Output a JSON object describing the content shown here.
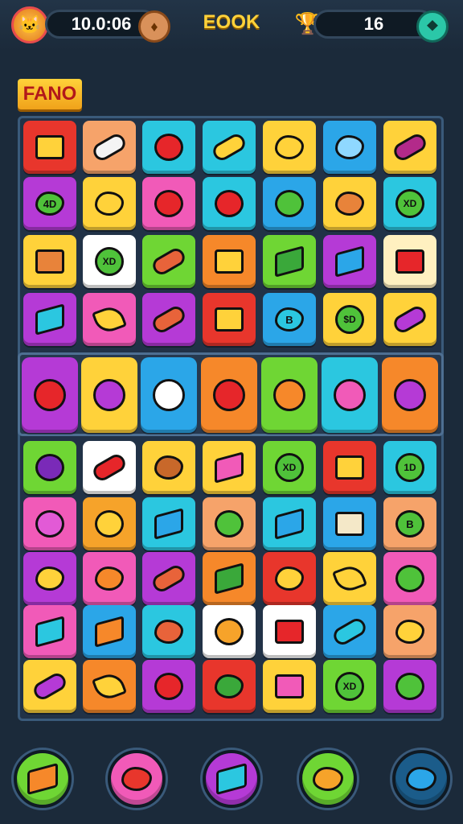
{
  "header": {
    "score_value": "10.0:06",
    "title": "EOOK",
    "right_counter": "16",
    "avatar_icon": "cat-face-icon",
    "left_coin_icon": "coin-icon",
    "right_trophy_icon": "trophy-icon",
    "right_action_icon": "leaf-icon"
  },
  "level": {
    "tag": "FANO"
  },
  "board": {
    "rows": [
      [
        {
          "bg": "#e8362c",
          "fill": "#ffd23a",
          "shape": "box",
          "icon": "crate-icon",
          "label": ""
        },
        {
          "bg": "#f6a36a",
          "fill": "#f4f4f4",
          "shape": "bar",
          "icon": "soap-icon",
          "label": ""
        },
        {
          "bg": "#2bc7e0",
          "fill": "#e6262a",
          "shape": "round",
          "icon": "tomato-icon",
          "label": ""
        },
        {
          "bg": "#2bc7e0",
          "fill": "#ffd23a",
          "shape": "bar",
          "icon": "banana-icon",
          "label": ""
        },
        {
          "bg": "#ffd23a",
          "fill": "#ffd23a",
          "shape": "blob",
          "icon": "bread-icon",
          "label": ""
        },
        {
          "bg": "#2ba6e8",
          "fill": "#8fd8ff",
          "shape": "blob",
          "icon": "flower-icon",
          "label": ""
        },
        {
          "bg": "#ffd23a",
          "fill": "#b32a8a",
          "shape": "bar",
          "icon": "eggplant-icon",
          "label": ""
        }
      ],
      [
        {
          "bg": "#b53ad6",
          "fill": "#4fc23a",
          "shape": "blob",
          "icon": "leaf-icon",
          "label": "4D"
        },
        {
          "bg": "#ffd23a",
          "fill": "#ffd23a",
          "shape": "blob",
          "icon": "bread-icon",
          "label": ""
        },
        {
          "bg": "#f15ab8",
          "fill": "#e6262a",
          "shape": "round",
          "icon": "tomato-icon",
          "label": ""
        },
        {
          "bg": "#2bc7e0",
          "fill": "#e6262a",
          "shape": "round",
          "icon": "tomato-icon",
          "label": ""
        },
        {
          "bg": "#2ba6e8",
          "fill": "#4fc23a",
          "shape": "round",
          "icon": "apple-icon",
          "label": ""
        },
        {
          "bg": "#ffd23a",
          "fill": "#e8833a",
          "shape": "blob",
          "icon": "potato-icon",
          "label": ""
        },
        {
          "bg": "#2bc7e0",
          "fill": "#4fc23a",
          "shape": "coin",
          "icon": "token-icon",
          "label": "XD"
        }
      ],
      [
        {
          "bg": "#ffd23a",
          "fill": "#e8833a",
          "shape": "box",
          "icon": "crate-icon",
          "label": ""
        },
        {
          "bg": "#ffffff",
          "fill": "#4fc23a",
          "shape": "coin",
          "icon": "token-icon",
          "label": "XD"
        },
        {
          "bg": "#6fd634",
          "fill": "#e8633a",
          "shape": "bar",
          "icon": "carrot-icon",
          "label": ""
        },
        {
          "bg": "#f6882a",
          "fill": "#ffd23a",
          "shape": "box",
          "icon": "crate-icon",
          "label": ""
        },
        {
          "bg": "#6fd634",
          "fill": "#3aa83a",
          "shape": "cube",
          "icon": "block-icon",
          "label": ""
        },
        {
          "bg": "#b53ad6",
          "fill": "#2ba6e8",
          "shape": "cube",
          "icon": "block-icon",
          "label": ""
        },
        {
          "bg": "#fff0c0",
          "fill": "#e6262a",
          "shape": "box",
          "icon": "berry-icon",
          "label": ""
        }
      ],
      [
        {
          "bg": "#b53ad6",
          "fill": "#2bc7e0",
          "shape": "cube",
          "icon": "block-icon",
          "label": ""
        },
        {
          "bg": "#f15ab8",
          "fill": "#ffd23a",
          "shape": "wedge",
          "icon": "cheese-icon",
          "label": ""
        },
        {
          "bg": "#b53ad6",
          "fill": "#e8633a",
          "shape": "bar",
          "icon": "carrot-icon",
          "label": ""
        },
        {
          "bg": "#e8362c",
          "fill": "#ffd23a",
          "shape": "box",
          "icon": "cheese-block-icon",
          "label": ""
        },
        {
          "bg": "#2ba6e8",
          "fill": "#2bc7e0",
          "shape": "blob",
          "icon": "shield-icon",
          "label": "B"
        },
        {
          "bg": "#ffd23a",
          "fill": "#4fc23a",
          "shape": "coin",
          "icon": "token-icon",
          "label": "$D"
        },
        {
          "bg": "#ffd23a",
          "fill": "#b53ad6",
          "shape": "bar",
          "icon": "radish-icon",
          "label": ""
        }
      ]
    ],
    "special_row": [
      {
        "bg": "#b53ad6",
        "fill": "#e6262a",
        "icon": "lollipop-icon"
      },
      {
        "bg": "#ffd23a",
        "fill": "#b53ad6",
        "icon": "lollipop-icon"
      },
      {
        "bg": "#2ba6e8",
        "fill": "#ffffff",
        "icon": "onion-icon"
      },
      {
        "bg": "#f6882a",
        "fill": "#e6262a",
        "icon": "jelly-icon"
      },
      {
        "bg": "#6fd634",
        "fill": "#f6882a",
        "icon": "pineapple-icon"
      },
      {
        "bg": "#2bc7e0",
        "fill": "#f15ab8",
        "icon": "candy-cube-icon"
      },
      {
        "bg": "#f6882a",
        "fill": "#b53ad6",
        "icon": "lollipop-icon"
      }
    ],
    "rows_lower": [
      [
        {
          "bg": "#6fd634",
          "fill": "#7a2ab8",
          "shape": "round",
          "icon": "plum-icon",
          "label": ""
        },
        {
          "bg": "#ffffff",
          "fill": "#e6262a",
          "shape": "bar",
          "icon": "candy-bar-icon",
          "label": ""
        },
        {
          "bg": "#ffd23a",
          "fill": "#c8682a",
          "shape": "blob",
          "icon": "potato-icon",
          "label": ""
        },
        {
          "bg": "#ffd23a",
          "fill": "#f15ab8",
          "shape": "cube",
          "icon": "candy-cube-icon",
          "label": ""
        },
        {
          "bg": "#6fd634",
          "fill": "#4fc23a",
          "shape": "coin",
          "icon": "token-icon",
          "label": "XD"
        },
        {
          "bg": "#e8362c",
          "fill": "#ffd23a",
          "shape": "box",
          "icon": "crate-icon",
          "label": ""
        },
        {
          "bg": "#2bc7e0",
          "fill": "#4fc23a",
          "shape": "coin",
          "icon": "token-icon",
          "label": "1D"
        }
      ],
      [
        {
          "bg": "#f15ab8",
          "fill": "#e25ad6",
          "shape": "round",
          "icon": "peach-icon",
          "label": ""
        },
        {
          "bg": "#f6a32a",
          "fill": "#ffd23a",
          "shape": "round",
          "icon": "lemon-icon",
          "label": ""
        },
        {
          "bg": "#2bc7e0",
          "fill": "#2ba6e8",
          "shape": "cube",
          "icon": "block-icon",
          "label": ""
        },
        {
          "bg": "#f6a36a",
          "fill": "#4fc23a",
          "shape": "round",
          "icon": "apple-icon",
          "label": ""
        },
        {
          "bg": "#2bc7e0",
          "fill": "#2ba6e8",
          "shape": "cube",
          "icon": "block-icon",
          "label": ""
        },
        {
          "bg": "#2ba6e8",
          "fill": "#f4e8c8",
          "shape": "box",
          "icon": "box-icon",
          "label": ""
        },
        {
          "bg": "#f6a36a",
          "fill": "#4fc23a",
          "shape": "round",
          "icon": "apple-icon",
          "label": "B"
        }
      ],
      [
        {
          "bg": "#b53ad6",
          "fill": "#ffd23a",
          "shape": "blob",
          "icon": "bread-icon",
          "label": ""
        },
        {
          "bg": "#f15ab8",
          "fill": "#f6882a",
          "shape": "blob",
          "icon": "berry-icon",
          "label": ""
        },
        {
          "bg": "#b53ad6",
          "fill": "#e8633a",
          "shape": "bar",
          "icon": "carrot-icon",
          "label": ""
        },
        {
          "bg": "#f6882a",
          "fill": "#3aa83a",
          "shape": "cube",
          "icon": "block-icon",
          "label": ""
        },
        {
          "bg": "#e8362c",
          "fill": "#ffd23a",
          "shape": "blob",
          "icon": "bread-icon",
          "label": ""
        },
        {
          "bg": "#ffd23a",
          "fill": "#ffd23a",
          "shape": "wedge",
          "icon": "cheese-icon",
          "label": ""
        },
        {
          "bg": "#f15ab8",
          "fill": "#4fc23a",
          "shape": "round",
          "icon": "apple-icon",
          "label": ""
        }
      ],
      [
        {
          "bg": "#f15ab8",
          "fill": "#2bc7e0",
          "shape": "cube",
          "icon": "block-icon",
          "label": ""
        },
        {
          "bg": "#2ba6e8",
          "fill": "#f6882a",
          "shape": "cube",
          "icon": "block-icon",
          "label": ""
        },
        {
          "bg": "#2bc7e0",
          "fill": "#e8633a",
          "shape": "blob",
          "icon": "potato-icon",
          "label": ""
        },
        {
          "bg": "#ffffff",
          "fill": "#f6a32a",
          "shape": "round",
          "icon": "orange-icon",
          "label": ""
        },
        {
          "bg": "#ffffff",
          "fill": "#e6262a",
          "shape": "box",
          "icon": "berry-icon",
          "label": ""
        },
        {
          "bg": "#2ba6e8",
          "fill": "#2bc7e0",
          "shape": "bar",
          "icon": "eggplant-icon",
          "label": ""
        },
        {
          "bg": "#f6a36a",
          "fill": "#ffd23a",
          "shape": "blob",
          "icon": "bread-icon",
          "label": ""
        }
      ],
      [
        {
          "bg": "#ffd23a",
          "fill": "#b53ad6",
          "shape": "bar",
          "icon": "eggplant-icon",
          "label": ""
        },
        {
          "bg": "#f6882a",
          "fill": "#ffd23a",
          "shape": "wedge",
          "icon": "cheese-icon",
          "label": ""
        },
        {
          "bg": "#b53ad6",
          "fill": "#e6262a",
          "shape": "round",
          "icon": "tomato-icon",
          "label": ""
        },
        {
          "bg": "#e8362c",
          "fill": "#3aa83a",
          "shape": "blob",
          "icon": "block-icon",
          "label": ""
        },
        {
          "bg": "#ffd23a",
          "fill": "#f15ab8",
          "shape": "box",
          "icon": "candy-cube-icon",
          "label": ""
        },
        {
          "bg": "#6fd634",
          "fill": "#4fc23a",
          "shape": "coin",
          "icon": "token-icon",
          "label": "XD"
        },
        {
          "bg": "#b53ad6",
          "fill": "#4fc23a",
          "shape": "round",
          "icon": "apple-icon",
          "label": ""
        }
      ]
    ]
  },
  "boosters": [
    {
      "bg": "#6fd634",
      "fill": "#f6882a",
      "shape": "cube",
      "icon": "block-booster-icon"
    },
    {
      "bg": "#f15ab8",
      "fill": "#e8362c",
      "shape": "blob",
      "icon": "strawberry-booster-icon"
    },
    {
      "bg": "#b53ad6",
      "fill": "#2bc7e0",
      "shape": "cube",
      "icon": "block-booster-icon"
    },
    {
      "bg": "#6fd634",
      "fill": "#f6a32a",
      "shape": "blob",
      "icon": "bread-booster-icon"
    },
    {
      "bg": "#1b5c8a",
      "fill": "#2ba6e8",
      "shape": "blob",
      "icon": "gear-icon"
    }
  ]
}
